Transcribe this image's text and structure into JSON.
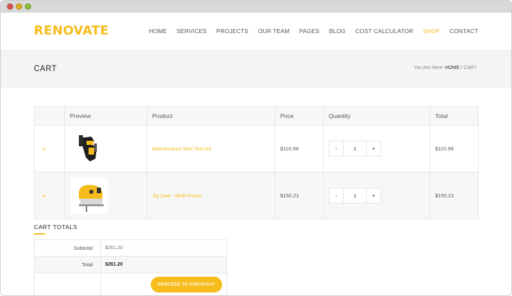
{
  "site": {
    "logo": "RENOVATE",
    "brand_color": "#f5bc1c"
  },
  "nav": {
    "items": [
      {
        "label": "HOME",
        "active": false
      },
      {
        "label": "SERVICES",
        "active": false
      },
      {
        "label": "PROJECTS",
        "active": false
      },
      {
        "label": "OUR TEAM",
        "active": false
      },
      {
        "label": "PAGES",
        "active": false
      },
      {
        "label": "BLOG",
        "active": false
      },
      {
        "label": "COST CALCULATOR",
        "active": false
      },
      {
        "label": "SHOP",
        "active": true
      },
      {
        "label": "CONTACT",
        "active": false
      }
    ]
  },
  "page": {
    "title": "CART",
    "breadcrumb_prefix": "You Are Here: ",
    "breadcrumb_home": "HOME",
    "breadcrumb_sep": " / ",
    "breadcrumb_current": "CART"
  },
  "cart": {
    "columns": [
      "Preview",
      "Product",
      "Price",
      "Quantity",
      "Total"
    ],
    "remove_symbol": "×",
    "minus_symbol": "-",
    "plus_symbol": "+",
    "items": [
      {
        "product": "Maintenance Mini Tool Kit",
        "price": "$110.99",
        "quantity": "1",
        "total": "$110.99",
        "image_icon": "tool-belt-icon"
      },
      {
        "product": "Jig Saw - Multi Power",
        "price": "$150.21",
        "quantity": "1",
        "total": "$150.21",
        "image_icon": "jigsaw-icon"
      }
    ]
  },
  "totals": {
    "title": "CART TOTALS",
    "subtotal_label": "Subtotal",
    "subtotal_value": "$261.20",
    "total_label": "Total",
    "total_value": "$261.20",
    "checkout_label": "PROCEED TO CHECKOUT"
  }
}
